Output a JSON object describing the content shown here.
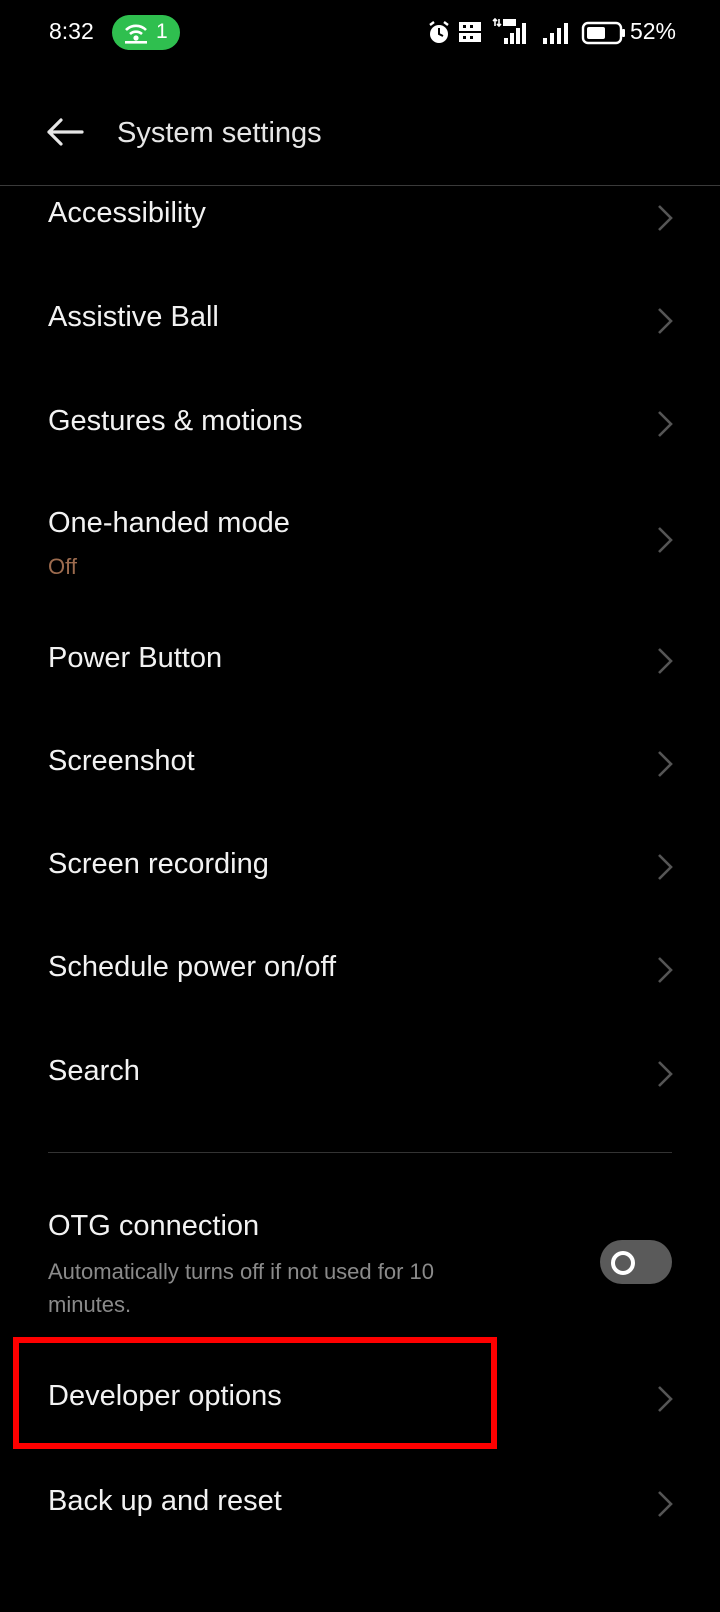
{
  "status_bar": {
    "time": "8:32",
    "hotspot_count": "1",
    "battery_text": "52%",
    "icons": [
      "hotspot-icon",
      "alarm-icon",
      "volte-icon",
      "4g-signal-icon",
      "signal-icon",
      "battery-icon"
    ]
  },
  "header": {
    "title": "System settings",
    "back_icon": "back-arrow-icon"
  },
  "items": [
    {
      "title": "Accessibility"
    },
    {
      "title": "Assistive Ball"
    },
    {
      "title": "Gestures & motions"
    },
    {
      "title": "One-handed mode",
      "subtitle": "Off"
    },
    {
      "title": "Power Button"
    },
    {
      "title": "Screenshot"
    },
    {
      "title": "Screen recording"
    },
    {
      "title": "Schedule power on/off"
    },
    {
      "title": "Search"
    },
    {
      "title": "OTG connection",
      "subtitle": "Automatically turns off if not used for 10 minutes.",
      "toggle": false
    },
    {
      "title": "Developer options"
    },
    {
      "title": "Back up and reset"
    }
  ],
  "colors": {
    "background": "#000000",
    "hotspot_green": "#2fbf4f",
    "subtitle_off": "#9c6b4e",
    "highlight_red": "#ff0000",
    "toggle_off": "#5a5a5a"
  }
}
